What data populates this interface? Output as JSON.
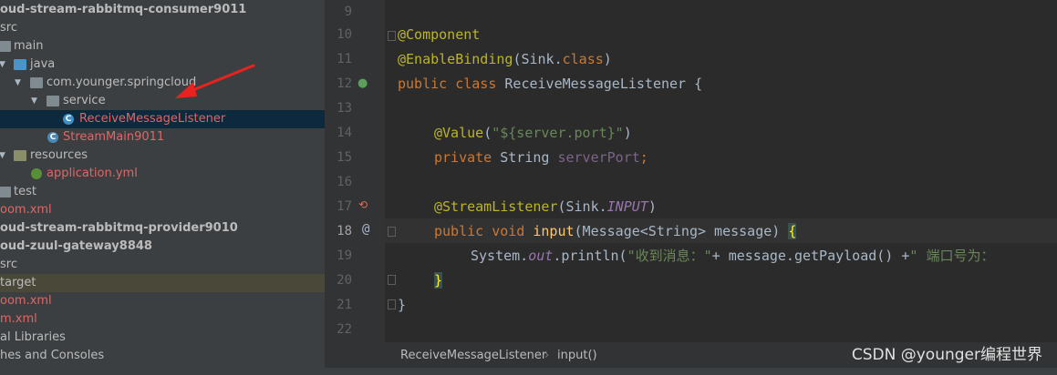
{
  "project_tree": {
    "items": [
      {
        "label": "oud-stream-rabbitmq-consumer9011",
        "style": "bold"
      },
      {
        "label": "src"
      },
      {
        "label": "main"
      },
      {
        "label": "java"
      },
      {
        "label": "com.younger.springcloud"
      },
      {
        "label": "service"
      },
      {
        "label": "ReceiveMessageListener",
        "style": "red selected"
      },
      {
        "label": "StreamMain9011",
        "style": "red"
      },
      {
        "label": "resources"
      },
      {
        "label": "application.yml",
        "style": "red"
      },
      {
        "label": "test"
      },
      {
        "label": "oom.xml",
        "style": "red"
      },
      {
        "label": "oud-stream-rabbitmq-provider9010",
        "style": "bold"
      },
      {
        "label": "oud-zuul-gateway8848",
        "style": "bold"
      },
      {
        "label": "src"
      },
      {
        "label": "target",
        "style": "target"
      },
      {
        "label": "oom.xml",
        "style": "red"
      },
      {
        "label": "m.xml",
        "style": "red"
      },
      {
        "label": "al Libraries"
      },
      {
        "label": "hes and Consoles"
      }
    ]
  },
  "editor": {
    "line_numbers": [
      "9",
      "10",
      "11",
      "12",
      "13",
      "14",
      "15",
      "16",
      "17",
      "18",
      "19",
      "20",
      "21",
      "22"
    ],
    "current_line": "18",
    "code": {
      "l10_ann": "@Component",
      "l11_ann": "@EnableBinding",
      "l11_rest_a": "(Sink.",
      "l11_kw": "class",
      "l11_rest_b": ")",
      "l12_kw": "public class",
      "l12_rest": " ReceiveMessageListener {",
      "l14_ann": "@Value",
      "l14_a": "(",
      "l14_str": "\"${server.port}\"",
      "l14_b": ")",
      "l15_kw": "private",
      "l15_type": " String ",
      "l15_field": "serverPort",
      "l15_semi": ";",
      "l17_ann": "@StreamListener",
      "l17_a": "(Sink.",
      "l17_const": "INPUT",
      "l17_b": ")",
      "l18_kw": "public void",
      "l18_sp": " ",
      "l18_fn": "input",
      "l18_rest": "(Message<String> message) ",
      "l18_brace": "{",
      "l19_a": "System.",
      "l19_field": "out",
      "l19_b": ".println(",
      "l19_str1": "\"收到消息：\"",
      "l19_c": "+ message.getPayload() +",
      "l19_str2": "\" 端口号为：",
      "l20_brace": "}",
      "l21_brace": "}"
    }
  },
  "breadcrumb": {
    "items": [
      "ReceiveMessageListener",
      "input()"
    ],
    "separator": "›"
  },
  "watermark": "CSDN @younger编程世界",
  "colors": {
    "annotation": "#bbb529",
    "keyword": "#cc7832",
    "string": "#6a8759",
    "field": "#9876aa",
    "function": "#ffc66d",
    "arrow": "#e8231f"
  }
}
